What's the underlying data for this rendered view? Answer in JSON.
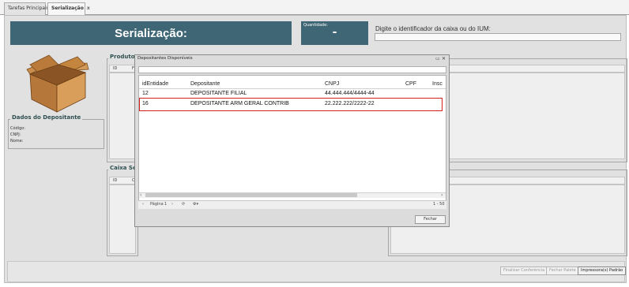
{
  "tabs": [
    {
      "label": "Tarefas Principais"
    },
    {
      "label": "Serialização"
    }
  ],
  "tab_close": "x",
  "header": {
    "title": "Serialização:",
    "quantity_label": "Quantidade:",
    "quantity_value": "-",
    "identifier_label": "Digite o identificador da caixa ou do IUM:",
    "identifier_value": ""
  },
  "depositante_panel": {
    "legend": "Dados do Depositante",
    "fields": [
      "Código:",
      "CNPJ:",
      "Nome:"
    ]
  },
  "produtos_panel": {
    "legend": "Produto",
    "col_id": "ID",
    "col_b": "F"
  },
  "caixa_panel": {
    "legend": "Caixa Se",
    "col_id": "ID",
    "col_b": "C"
  },
  "right_panel2": {
    "legend": "s"
  },
  "modal": {
    "title": "Depositantes Disponíveis",
    "ctrl_restore": "▭",
    "ctrl_close": "✕",
    "columns": [
      "idEntidade",
      "Depositante",
      "CNPJ",
      "CPF",
      "Insc"
    ],
    "rows": [
      {
        "id": "12",
        "depositante": "DEPOSITANTE FILIAL",
        "cnpj": "44.444.444/4444-44",
        "cpf": ""
      },
      {
        "id": "16",
        "depositante": "DEPOSITANTE ARM GERAL CONTRIB",
        "cnpj": "22.222.222/2222-22",
        "cpf": ""
      }
    ],
    "selected_row": 1,
    "pager": {
      "page_label": "Página",
      "page_value": "1",
      "range": "1 - 50"
    },
    "close_label": "Fechar"
  },
  "bottom_buttons": [
    {
      "label": "Finalizar Conferência",
      "enabled": false
    },
    {
      "label": "Fechar Palete",
      "enabled": false
    },
    {
      "label": "Impressora(s) Padrão",
      "enabled": true
    }
  ],
  "colors": {
    "header_band": "#3f6674",
    "selection_outline": "#d21e1e"
  }
}
